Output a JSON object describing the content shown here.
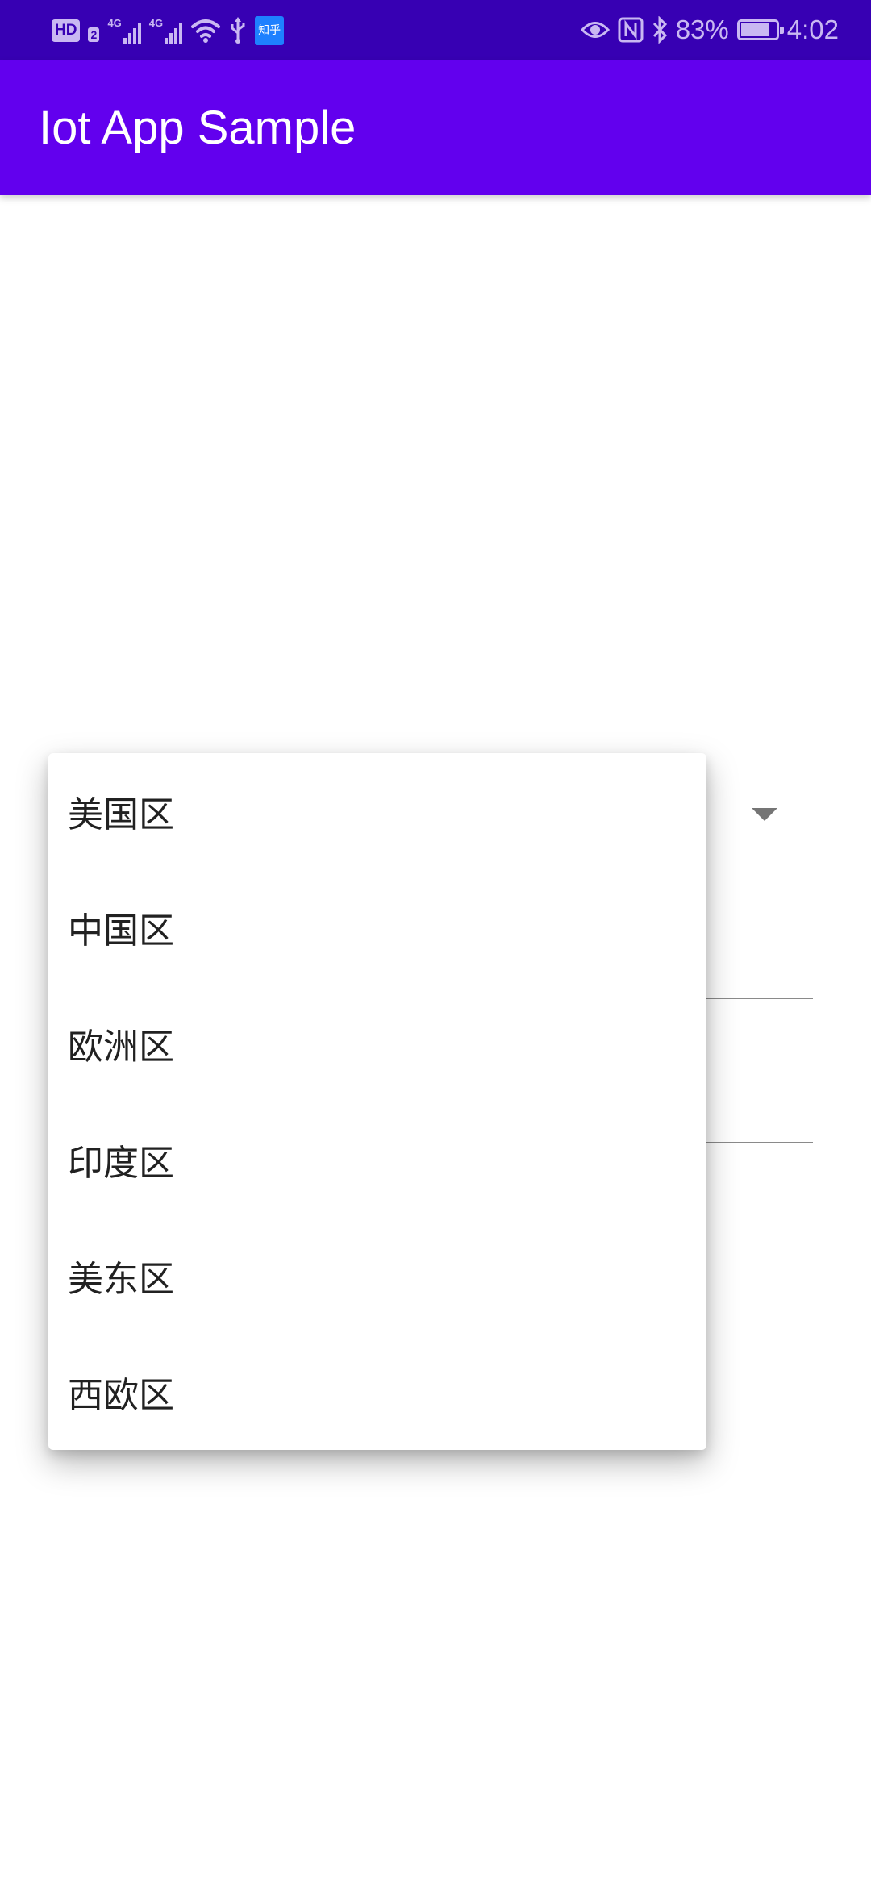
{
  "status_bar": {
    "hd_label": "HD",
    "sim_label": "2",
    "network_labels": [
      "4G",
      "4G"
    ],
    "app_notification_label": "知乎",
    "battery_percent": "83%",
    "battery_level": 0.83,
    "time": "4:02"
  },
  "app_bar": {
    "title": "Iot App Sample"
  },
  "region_dropdown": {
    "options": [
      "美国区",
      "中国区",
      "欧洲区",
      "印度区",
      "美东区",
      "西欧区"
    ]
  },
  "colors": {
    "status_bar": "#3700b3",
    "app_bar": "#6200ee",
    "status_icons": "#c9b8f2",
    "menu_text": "#212121"
  },
  "icons": [
    "hd-icon",
    "signal-icon",
    "wifi-icon",
    "usb-icon",
    "eye-icon",
    "nfc-icon",
    "bluetooth-icon",
    "battery-icon",
    "dropdown-arrow-icon"
  ]
}
